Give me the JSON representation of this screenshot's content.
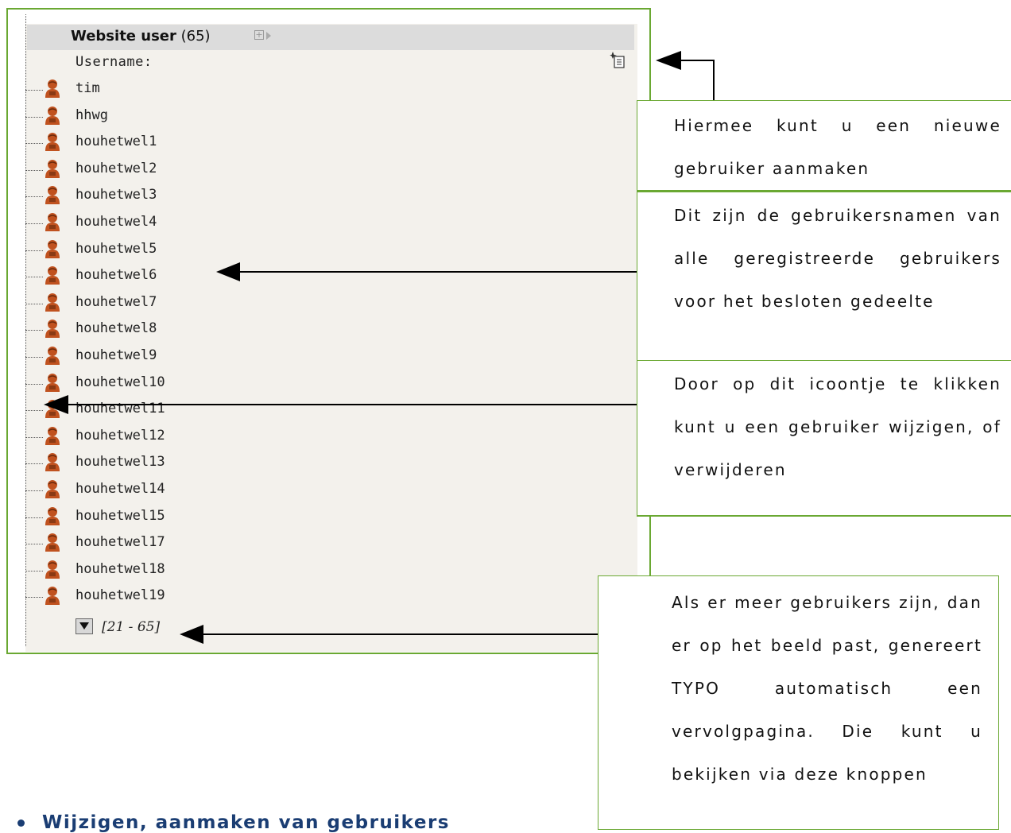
{
  "panel": {
    "title": "Website user",
    "count": "(65)",
    "username_label": "Username:",
    "users": [
      "tim",
      "hhwg",
      "houhetwel1",
      "houhetwel2",
      "houhetwel3",
      "houhetwel4",
      "houhetwel5",
      "houhetwel6",
      "houhetwel7",
      "houhetwel8",
      "houhetwel9",
      "houhetwel10",
      "houhetwel11",
      "houhetwel12",
      "houhetwel13",
      "houhetwel14",
      "houhetwel15",
      "houhetwel17",
      "houhetwel18",
      "houhetwel19"
    ],
    "pager_range": "[21 - 65]"
  },
  "notes": {
    "new_user": "Hiermee kunt u een nieuwe gebruiker aanmaken",
    "usernames": "Dit zijn de gebruikersnamen van alle geregistreerde gebruikers voor het besloten gedeelte",
    "icon": "Door op dit icoontje te klikken kunt u een gebruiker wijzigen, of verwijderen",
    "paging": "Als er meer gebruikers zijn, dan er op het beeld past, genereert TYPO automatisch een vervolgpagina. Die kunt u bekijken via deze knoppen"
  },
  "bottom_heading": "Wijzigen, aanmaken van gebruikers",
  "colors": {
    "frame": "#6aa832",
    "heading": "#1a3d73",
    "user_icon": "#c0521f"
  },
  "icons": {
    "user": "user-icon",
    "new_record": "new-record-icon",
    "pager": "pager-down-icon"
  }
}
